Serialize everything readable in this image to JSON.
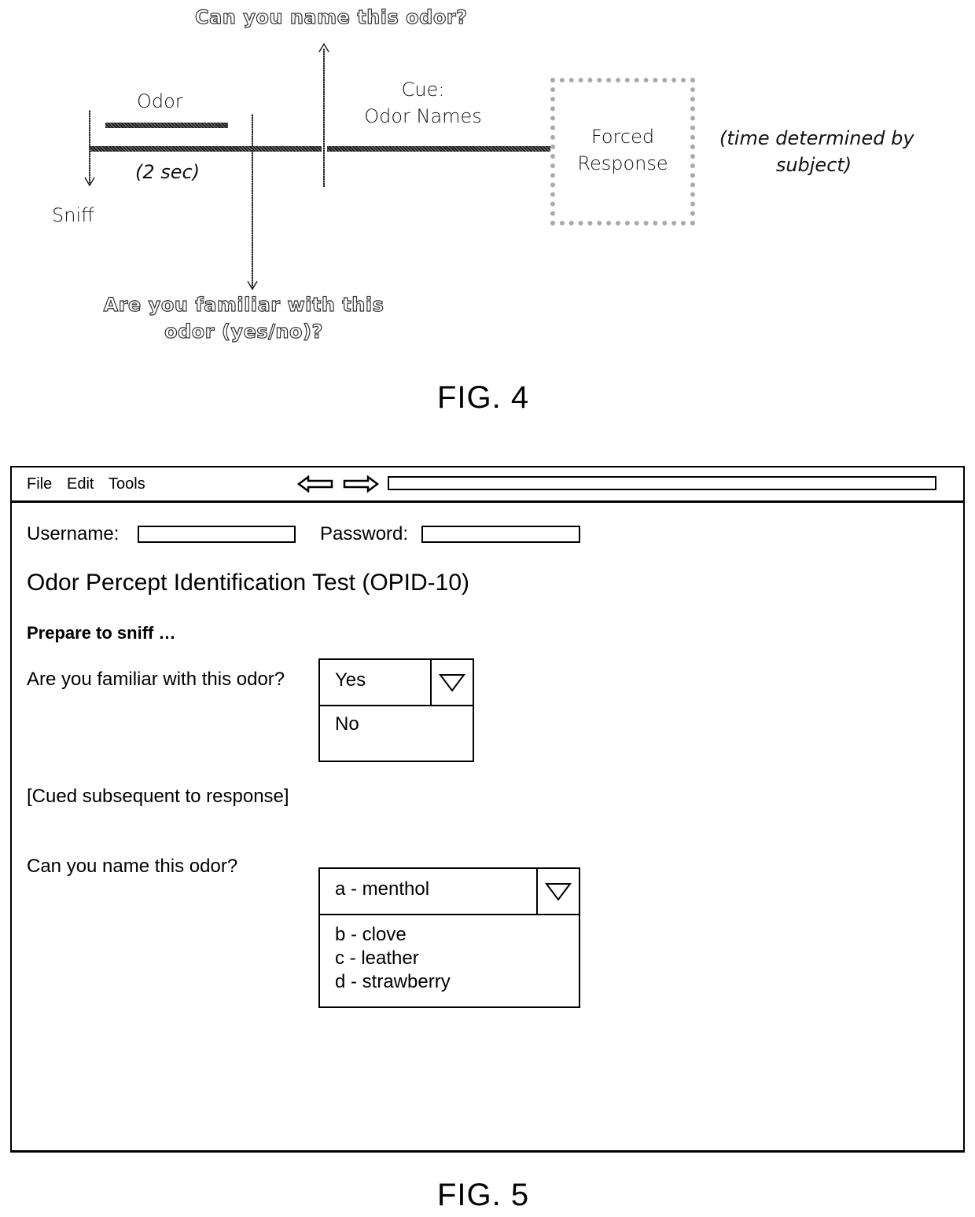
{
  "fig4": {
    "label": "FIG. 4",
    "question_top": "Can you name this odor?",
    "question_bottom_line1": "Are you familiar with this",
    "question_bottom_line2": "odor (yes/no)?",
    "odor_label": "Odor",
    "duration_label": "(2 sec)",
    "sniff_label": "Sniff",
    "cue_line1": "Cue:",
    "cue_line2": "Odor Names",
    "forced_line1": "Forced",
    "forced_line2": "Response",
    "time_line1": "(time determined by",
    "time_line2": "subject)"
  },
  "fig5": {
    "label": "FIG. 5",
    "menu": [
      "File",
      "Edit",
      "Tools"
    ],
    "nav": {
      "back_icon": "left-arrow-icon",
      "forward_icon": "right-arrow-icon"
    },
    "address_value": "",
    "username_label": "Username:",
    "username_value": "",
    "password_label": "Password:",
    "password_value": "",
    "title": "Odor Percept Identification Test (OPID-10)",
    "instruction": "Prepare to sniff …",
    "familiar": {
      "question": "Are you familiar with this odor?",
      "selected": "Yes",
      "options": [
        "No"
      ]
    },
    "cue_note": "[Cued subsequent to response]",
    "name_odor": {
      "question": "Can you name this odor?",
      "selected": "a - menthol",
      "options": [
        "b - clove",
        "c - leather",
        "d - strawberry"
      ]
    }
  }
}
